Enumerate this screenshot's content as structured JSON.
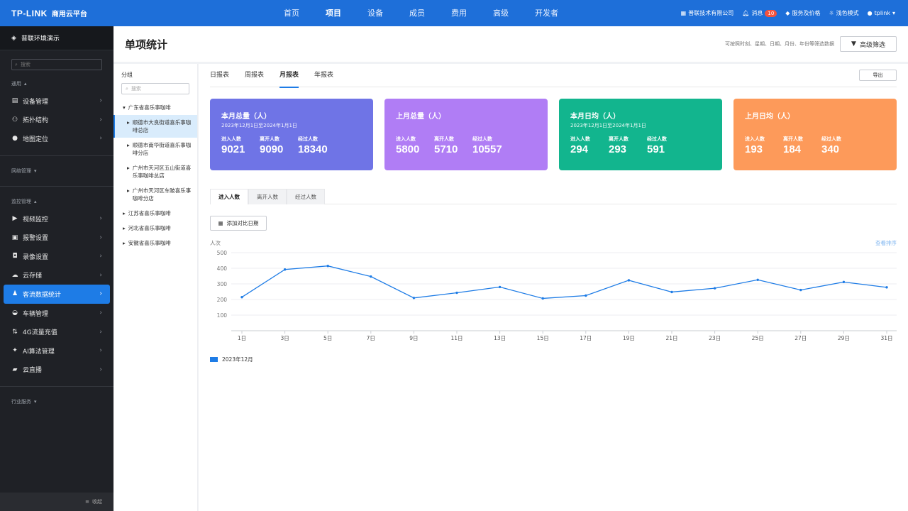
{
  "topbar": {
    "brand": "TP-LINK",
    "platform": "商用云平台",
    "nav": [
      "首页",
      "项目",
      "设备",
      "成员",
      "费用",
      "高级",
      "开发者"
    ],
    "active_nav": "项目",
    "company": "普联技术有限公司",
    "messages_label": "消息",
    "messages_count": "10",
    "service_label": "服务及价格",
    "theme_label": "浅色模式",
    "user": "tplink"
  },
  "sidebar": {
    "env": "普联环境演示",
    "search_placeholder": "搜索",
    "groups": [
      {
        "label": "通用",
        "items": [
          "设备管理",
          "拓扑结构",
          "地图定位"
        ]
      },
      {
        "label": "网络管理",
        "items": []
      },
      {
        "label": "监控管理",
        "items": [
          "视频监控",
          "报警设置",
          "录像设置",
          "云存储",
          "客流数据统计",
          "车辆管理",
          "4G流量充值",
          "AI算法管理",
          "云直播"
        ]
      },
      {
        "label": "行业服务",
        "items": []
      }
    ],
    "active_item": "客流数据统计",
    "collapse": "收起"
  },
  "header": {
    "title": "单项统计",
    "hint": "可按照时刻、星期、日期、月份、年份等筛选数据",
    "filter_btn": "高级筛选"
  },
  "tree": {
    "title": "分组",
    "search_placeholder": "搜索",
    "root": "广东省喜乐事咖啡",
    "children": [
      "顺德市大良街道喜乐事咖啡总店",
      "顺德市南华街道喜乐事咖啡分店",
      "广州市天河区五山街道喜乐事咖啡总店",
      "广州市天河区车陂喜乐事咖啡分店"
    ],
    "selected_child": 0,
    "others": [
      "江苏省喜乐事咖啡",
      "河北省喜乐事咖啡",
      "安徽省喜乐事咖啡"
    ]
  },
  "report": {
    "tabs": [
      "日报表",
      "周报表",
      "月报表",
      "年报表"
    ],
    "active_tab": "月报表",
    "export": "导出"
  },
  "cards": [
    {
      "title": "本月总量（人）",
      "date": "2023年12月1日至2024年1月1日",
      "color": "#6f74e6",
      "metrics": [
        {
          "label": "进入人数",
          "value": "9021"
        },
        {
          "label": "离开人数",
          "value": "9090"
        },
        {
          "label": "经过人数",
          "value": "18340"
        }
      ]
    },
    {
      "title": "上月总量（人）",
      "date": "",
      "color": "#b07df5",
      "metrics": [
        {
          "label": "进入人数",
          "value": "5800"
        },
        {
          "label": "离开人数",
          "value": "5710"
        },
        {
          "label": "经过人数",
          "value": "10557"
        }
      ]
    },
    {
      "title": "本月日均（人）",
      "date": "2023年12月1日至2024年1月1日",
      "color": "#12b58e",
      "metrics": [
        {
          "label": "进入人数",
          "value": "294"
        },
        {
          "label": "离开人数",
          "value": "293"
        },
        {
          "label": "经过人数",
          "value": "591"
        }
      ]
    },
    {
      "title": "上月日均（人）",
      "date": "",
      "color": "#fd9a5a",
      "metrics": [
        {
          "label": "进入人数",
          "value": "193"
        },
        {
          "label": "离开人数",
          "value": "184"
        },
        {
          "label": "经过人数",
          "value": "340"
        }
      ]
    }
  ],
  "subtabs": [
    "进入人数",
    "离开人数",
    "经过人数"
  ],
  "active_subtab": "进入人数",
  "compare_btn": "添加对比日期",
  "rank_link": "查看排序",
  "chart_data": {
    "type": "line",
    "ylabel": "人次",
    "ylim": [
      0,
      500
    ],
    "yticks": [
      100,
      200,
      300,
      400,
      500
    ],
    "x": [
      "1日",
      "3日",
      "5日",
      "7日",
      "9日",
      "11日",
      "13日",
      "15日",
      "17日",
      "19日",
      "21日",
      "23日",
      "25日",
      "27日",
      "29日",
      "31日"
    ],
    "series": [
      {
        "name": "2023年12月",
        "color": "#1e7ce6",
        "values": [
          215,
          392,
          415,
          347,
          210,
          243,
          280,
          207,
          225,
          323,
          248,
          272,
          326,
          261,
          312,
          278
        ]
      }
    ],
    "grid": true,
    "legend": "bottom-left"
  }
}
